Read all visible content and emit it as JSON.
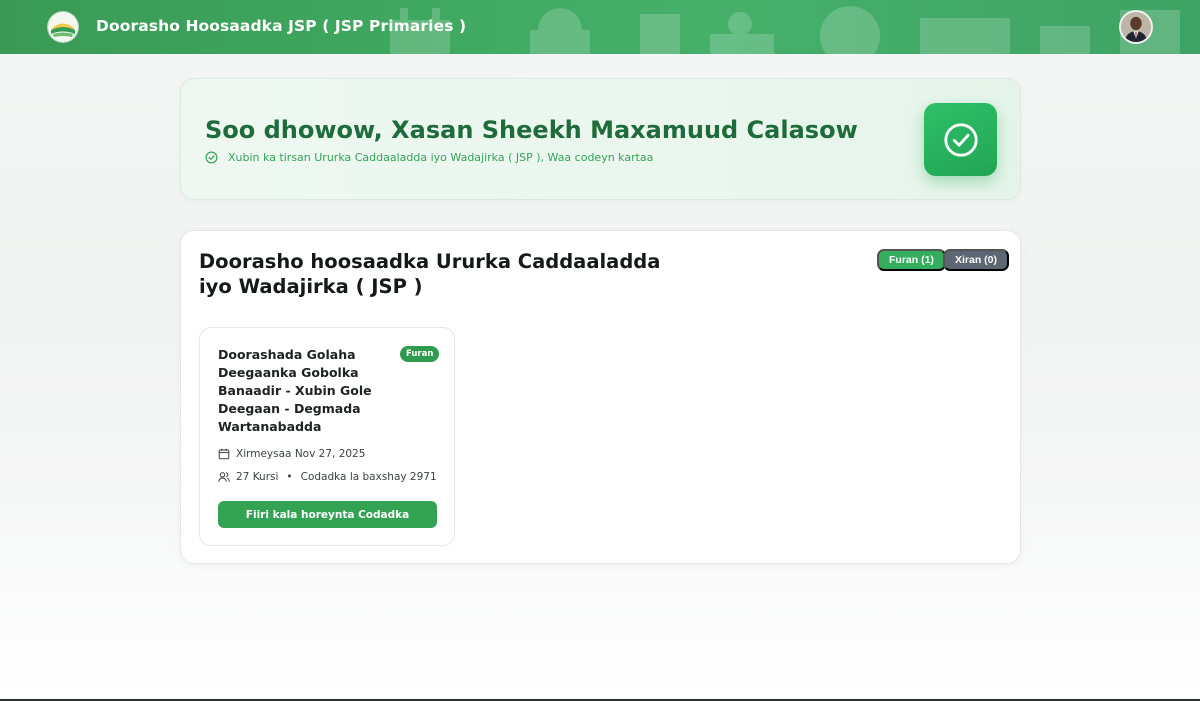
{
  "header": {
    "title": "Doorasho Hoosaadka JSP ( JSP Primaries )",
    "logo_icon": "party-logo-icon",
    "avatar_icon": "user-avatar"
  },
  "welcome": {
    "title": "Soo dhowow, Xasan Sheekh Maxamuud Calasow",
    "subtitle": "Xubin ka tirsan Ururka Caddaaladda iyo Wadajirka ( JSP ), Waa codeyn kartaa",
    "badge_icon": "check-circle-icon"
  },
  "elections": {
    "title": "Doorasho hoosaadka Ururka Caddaaladda iyo Wadajirka ( JSP )",
    "filters": {
      "open_label": "Furan (1)",
      "closed_label": "Xiran (0)"
    },
    "items": [
      {
        "title": "Doorashada Golaha Deegaanka Gobolka Banaadir - Xubin Gole Deegaan - Degmada Wartanabadda",
        "status": "Furan",
        "date_text": "Xirmeysaa Nov 27, 2025",
        "seats_text": "27 Kursi",
        "votes_text": "Codadka la baxshay 2971",
        "button_label": "Fiiri kala horeynta Codadka"
      }
    ]
  },
  "colors": {
    "brand_green": "#34a253",
    "dark_green_text": "#1e6b3b",
    "closed_gray": "#5d6673"
  }
}
